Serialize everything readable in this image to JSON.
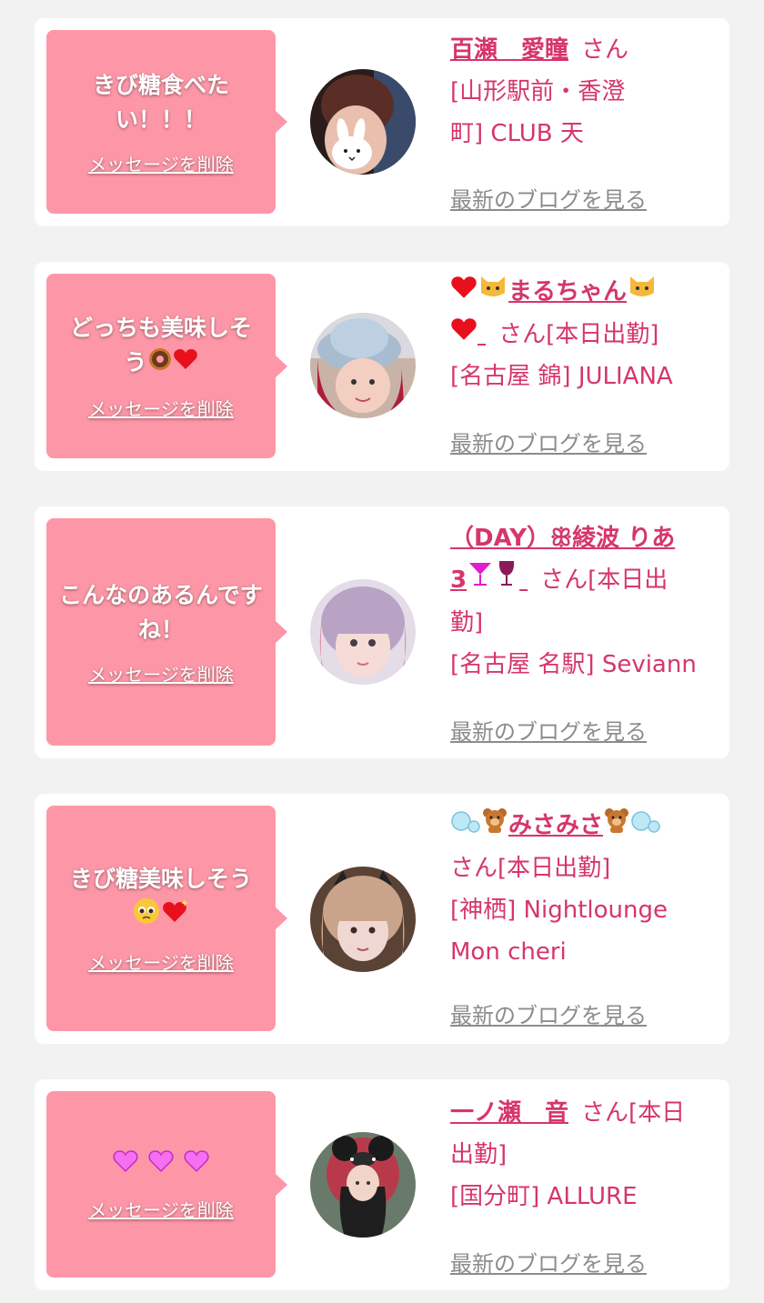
{
  "delete_label": "メッセージを削除",
  "blog_label": "最新のブログを見る",
  "colors": {
    "bubble": "#fd97a7",
    "accent": "#d6366a",
    "blog_link": "#8c8c8c",
    "background": "#f2f2f2"
  },
  "cards": [
    {
      "message": "きび糖食べたい！！！",
      "name": "百瀬　愛瞳",
      "suffix": "さん",
      "store_line1": "[山形駅前・香澄",
      "store_line2": "町] CLUB 天",
      "avatar_icon": "user-avatar-bunny"
    },
    {
      "message": "どっちも美味しそう",
      "message_icons": [
        "donut-icon",
        "heart-icon"
      ],
      "name": "まるちゃん",
      "name_icons": [
        "heart-icon",
        "cat-icon"
      ],
      "suffix": "さん[本日出勤]",
      "store": "[名古屋 錦] JULIANA",
      "avatar_icon": "user-avatar-hat"
    },
    {
      "message": "こんなのあるんですね！",
      "name": "（DAY）ꕥ綾波 りあ",
      "name_line2_prefix": "3",
      "name_icons": [
        "cocktail-icon",
        "wine-glass-icon"
      ],
      "suffix_line1": "さん[本日出",
      "suffix_line2": "勤]",
      "store": "[名古屋 名駅] Seviann",
      "avatar_icon": "user-avatar-pink-hair"
    },
    {
      "message": "きび糖美味しそう",
      "message_icons": [
        "pleading-face-icon",
        "sparkling-heart-icon"
      ],
      "name": "みさみさ",
      "name_icons": [
        "bubbles-icon",
        "teddy-bear-icon"
      ],
      "suffix": "さん[本日出勤]",
      "store_line1": "[神栖] Nightlounge",
      "store_line2": "Mon cheri",
      "avatar_icon": "user-avatar-cat-ears"
    },
    {
      "message": "",
      "message_icons": [
        "heart-icon",
        "heart-icon",
        "heart-icon"
      ],
      "name": "一ノ瀬　音",
      "suffix_line1": "さん[本日",
      "suffix_line2": "出勤]",
      "store": "[国分町] ALLURE",
      "avatar_icon": "user-avatar-ribbon"
    }
  ]
}
